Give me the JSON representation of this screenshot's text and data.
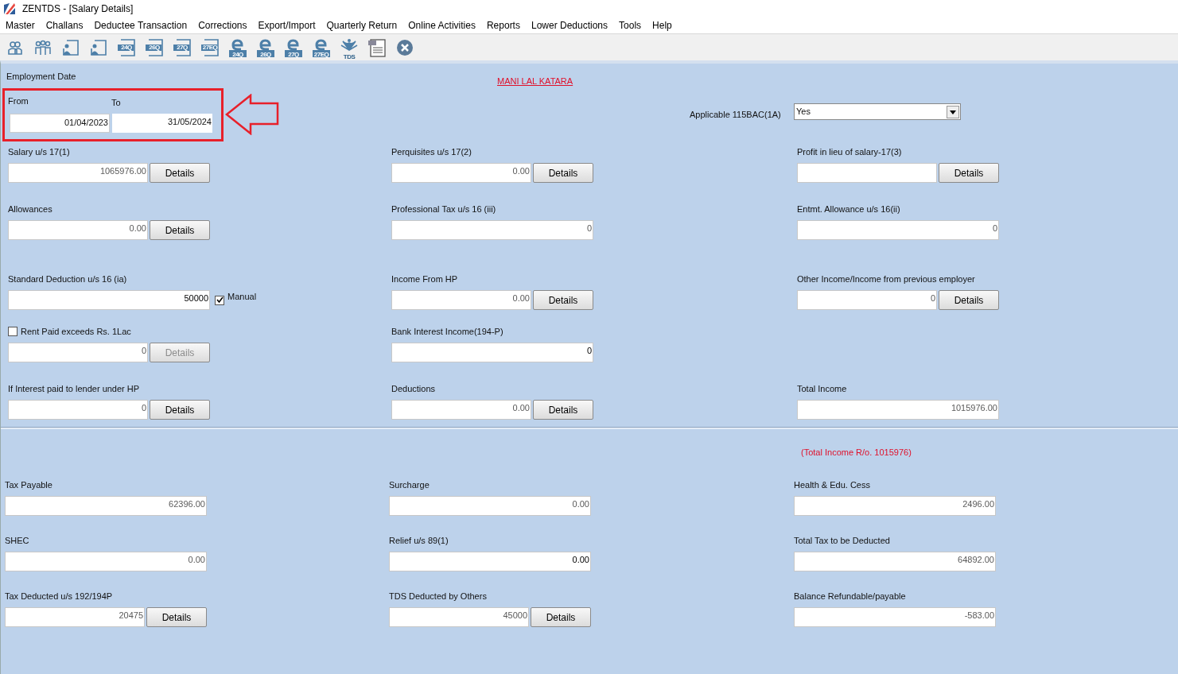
{
  "window": {
    "title": "ZENTDS - [Salary Details]"
  },
  "menu": [
    "Master",
    "Challans",
    "Deductee Transaction",
    "Corrections",
    "Export/Import",
    "Quarterly Return",
    "Online Activities",
    "Reports",
    "Lower Deductions",
    "Tools",
    "Help"
  ],
  "toolbar": [
    {
      "kind": "person"
    },
    {
      "kind": "group"
    },
    {
      "kind": "form"
    },
    {
      "kind": "form"
    },
    {
      "kind": "return",
      "label": "24Q"
    },
    {
      "kind": "return",
      "label": "26Q"
    },
    {
      "kind": "return",
      "label": "27Q"
    },
    {
      "kind": "return",
      "label": "27EQ"
    },
    {
      "kind": "efile",
      "label": "24Q"
    },
    {
      "kind": "efile",
      "label": "26Q"
    },
    {
      "kind": "efile",
      "label": "27Q"
    },
    {
      "kind": "efile",
      "label": "27EQ"
    },
    {
      "kind": "tds",
      "label": "TDS"
    },
    {
      "kind": "document"
    },
    {
      "kind": "close"
    }
  ],
  "employment": {
    "heading": "Employment Date",
    "from_label": "From",
    "from": "01/04/2023",
    "to_label": "To",
    "to": "31/05/2024"
  },
  "employee": "MANI LAL KATARA",
  "regime": {
    "label": "Applicable 115BAC(1A)",
    "value": "Yes"
  },
  "income_rows": [
    [
      {
        "label": "Salary u/s 17(1)",
        "value": "1065976.00",
        "dim": true,
        "button": "Details",
        "button_disabled": false
      },
      {
        "label": "Perquisites u/s 17(2)",
        "value": "0.00",
        "dim": true,
        "button": "Details",
        "button_disabled": false
      },
      {
        "label": "Profit in lieu of salary-17(3)",
        "button": "Details",
        "button_disabled": false
      }
    ],
    [
      {
        "label": "Allowances",
        "value": "0.00",
        "dim": true,
        "button": "Details",
        "button_disabled": false
      },
      {
        "label": "Professional Tax u/s 16 (iii)",
        "value": "0",
        "dim": true
      },
      {
        "label": "Entmt. Allowance u/s 16(ii)",
        "value": "0",
        "dim": true
      }
    ],
    [
      {
        "label": "Standard Deduction u/s 16 (ia)",
        "value": "50000",
        "dim": false,
        "option": "Manual",
        "option_checked": true
      },
      {
        "label": "Income From HP",
        "value": "0.00",
        "dim": true,
        "button": "Details",
        "button_disabled": false
      },
      {
        "label": "Other Income/Income from previous employer",
        "value": "0",
        "dim": true,
        "button": "Details",
        "button_disabled": false
      }
    ],
    [
      {
        "label": "Rent Paid exceeds Rs.  1Lac",
        "label_checked": false,
        "value": "0",
        "dim": true,
        "button": "Details",
        "button_disabled": true
      },
      {
        "label": "Bank Interest Income(194-P)",
        "value": "0",
        "dim": false
      },
      null
    ],
    [
      {
        "label": "If Interest paid to lender under HP",
        "value": "0",
        "dim": true,
        "button": "Details",
        "button_disabled": false
      },
      {
        "label": "Deductions",
        "value": "0.00",
        "dim": true,
        "button": "Details",
        "button_disabled": false
      },
      {
        "label": "Total Income",
        "value": "1015976.00",
        "dim": true
      }
    ]
  ],
  "note": "(Total Income R/o. 1015976)",
  "tax_rows": [
    [
      {
        "label": "Tax Payable",
        "value": "62396.00",
        "dim": true
      },
      {
        "label": "Surcharge",
        "value": "0.00",
        "dim": true
      },
      {
        "label": "Health & Edu. Cess",
        "value": "2496.00",
        "dim": true
      }
    ],
    [
      {
        "label": "SHEC",
        "value": "0.00",
        "dim": true
      },
      {
        "label": "Relief u/s 89(1)",
        "value": "0.00",
        "dim": false
      },
      {
        "label": "Total Tax to be Deducted",
        "value": "64892.00",
        "dim": true
      }
    ],
    [
      {
        "label": "Tax Deducted u/s 192/194P",
        "value": "20475",
        "dim": true,
        "button": "Details",
        "button_disabled": false
      },
      {
        "label": "TDS Deducted by Others",
        "value": "45000",
        "dim": true,
        "button": "Details",
        "button_disabled": false
      },
      {
        "label": "Balance Refundable/payable",
        "value": "-583.00",
        "dim": true
      }
    ]
  ]
}
